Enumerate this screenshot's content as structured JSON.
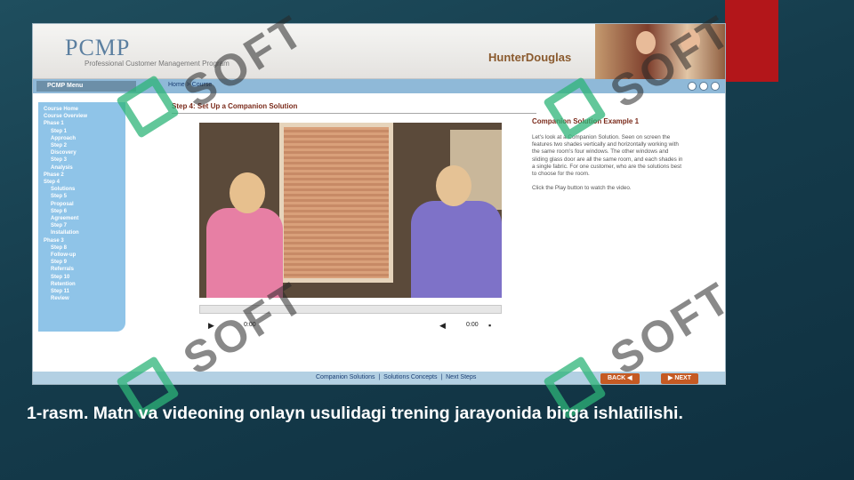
{
  "slide": {
    "caption": "1-rasm. Matn va videoning onlayn usulidagi trening jarayonida birga ishlatilishi."
  },
  "app": {
    "logo": "PCMP",
    "logo_subtitle": "Professional Customer Management Program",
    "brand": "HunterDouglas"
  },
  "nav": {
    "menu_label": "PCMP Menu",
    "breadcrumb": "Home  >  Course"
  },
  "sidebar": {
    "items": [
      {
        "label": "Course Home",
        "sub": false
      },
      {
        "label": "Course Overview",
        "sub": false
      },
      {
        "label": "Phase 1",
        "sub": false
      },
      {
        "label": "Step 1",
        "sub": true
      },
      {
        "label": "Approach",
        "sub": true
      },
      {
        "label": "Step 2",
        "sub": true
      },
      {
        "label": "Discovery",
        "sub": true
      },
      {
        "label": "Step 3",
        "sub": true
      },
      {
        "label": "Analysis",
        "sub": true
      },
      {
        "label": "Phase 2",
        "sub": false
      },
      {
        "label": "Step 4",
        "sub": false
      },
      {
        "label": "Solutions",
        "sub": true
      },
      {
        "label": "Step 5",
        "sub": true
      },
      {
        "label": "Proposal",
        "sub": true
      },
      {
        "label": "Step 6",
        "sub": true
      },
      {
        "label": "Agreement",
        "sub": true
      },
      {
        "label": "Step 7",
        "sub": true
      },
      {
        "label": "Installation",
        "sub": true
      },
      {
        "label": "Phase 3",
        "sub": false
      },
      {
        "label": "Step 8",
        "sub": true
      },
      {
        "label": "Follow-up",
        "sub": true
      },
      {
        "label": "Step 9",
        "sub": true
      },
      {
        "label": "Referrals",
        "sub": true
      },
      {
        "label": "Step 10",
        "sub": true
      },
      {
        "label": "Retention",
        "sub": true
      },
      {
        "label": "Step 11",
        "sub": true
      },
      {
        "label": "Review",
        "sub": true
      }
    ]
  },
  "content": {
    "step_title": "Step 4: Set Up a Companion Solution",
    "caption_title": "Companion Solution Example 1",
    "caption_body": "Let's look at a Companion Solution. Seen on screen the features two shades vertically and horizontally working with the same room's four windows. The other windows and sliding glass door are all the same room, and each shades in a single fabric. For one customer, who are the solutions best to choose for the room.",
    "caption_hint": "Click the Play button to watch the video."
  },
  "video": {
    "time_current": "0:00",
    "time_total": "0:00",
    "play_icon": "play-icon",
    "volume_icon": "volume-icon"
  },
  "footer": {
    "links": [
      "Companion Solutions",
      "Solutions Concepts",
      "Next Steps"
    ],
    "back_label": "BACK",
    "next_label": "NEXT"
  },
  "watermark": {
    "text": "SOFT"
  }
}
